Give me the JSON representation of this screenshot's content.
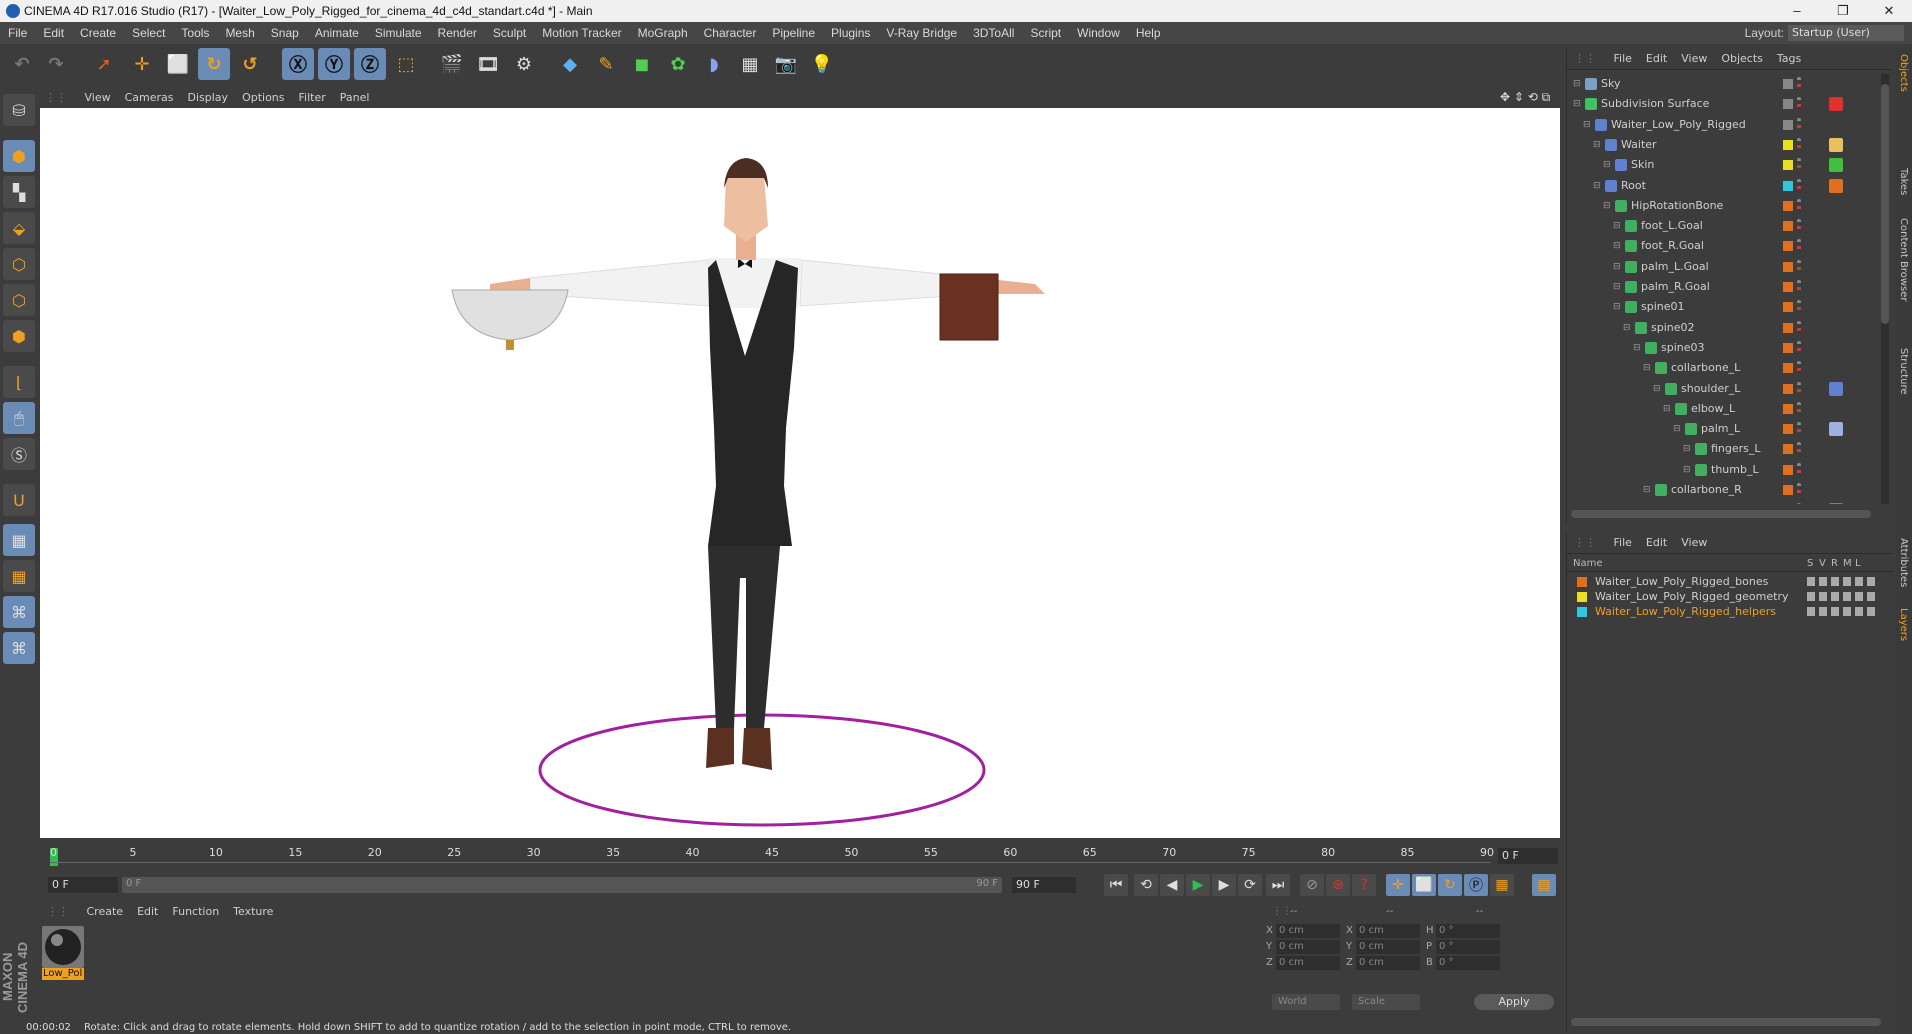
{
  "window": {
    "title": "CINEMA 4D R17.016 Studio (R17) - [Waiter_Low_Poly_Rigged_for_cinema_4d_c4d_standart.c4d *] - Main",
    "controls": [
      "–",
      "❐",
      "✕"
    ]
  },
  "menubar": {
    "items": [
      "File",
      "Edit",
      "Create",
      "Select",
      "Tools",
      "Mesh",
      "Snap",
      "Animate",
      "Simulate",
      "Render",
      "Sculpt",
      "Motion Tracker",
      "MoGraph",
      "Character",
      "Pipeline",
      "Plugins",
      "V-Ray Bridge",
      "3DToAll",
      "Script",
      "Window",
      "Help"
    ],
    "layout_label": "Layout:",
    "layout_value": "Startup (User)"
  },
  "viewport": {
    "menu": [
      "View",
      "Cameras",
      "Display",
      "Options",
      "Filter",
      "Panel"
    ],
    "nav_icons": [
      "move-view-icon",
      "zoom-view-icon",
      "rotate-view-icon",
      "maximize-view-icon"
    ]
  },
  "timeline": {
    "ticks": [
      "0",
      "5",
      "10",
      "15",
      "20",
      "25",
      "30",
      "35",
      "40",
      "45",
      "50",
      "55",
      "60",
      "65",
      "70",
      "75",
      "80",
      "85",
      "90"
    ],
    "current_frame": "0 F",
    "start_field": "0 F",
    "slider_start": "0 F",
    "slider_end": "90 F",
    "end_field": "90 F"
  },
  "material_manager": {
    "menu": [
      "Create",
      "Edit",
      "Function",
      "Texture"
    ],
    "material_name": "Low_Pol"
  },
  "coordinates": {
    "header": [
      "--",
      "--",
      "--"
    ],
    "rows": [
      {
        "a": "X",
        "av": "0 cm",
        "b": "X",
        "bv": "0 cm",
        "c": "H",
        "cv": "0 °"
      },
      {
        "a": "Y",
        "av": "0 cm",
        "b": "Y",
        "bv": "0 cm",
        "c": "P",
        "cv": "0 °"
      },
      {
        "a": "Z",
        "av": "0 cm",
        "b": "Z",
        "bv": "0 cm",
        "c": "B",
        "cv": "0 °"
      }
    ],
    "space": "World",
    "mode": "Scale",
    "apply": "Apply"
  },
  "status": {
    "time": "00:00:02",
    "message": "Rotate: Click and drag to rotate elements. Hold down SHIFT to add to quantize rotation / add to the selection in point mode, CTRL to remove."
  },
  "object_manager": {
    "menu": [
      "File",
      "Edit",
      "View",
      "Objects",
      "Tags"
    ],
    "objects": [
      {
        "name": "Sky",
        "indent": 0,
        "color": "#888888",
        "tag": ""
      },
      {
        "name": "Subdivision Surface",
        "indent": 0,
        "color": "#888888",
        "tag": "x"
      },
      {
        "name": "Waiter_Low_Poly_Rigged",
        "indent": 1,
        "color": "#888888",
        "tag": ""
      },
      {
        "name": "Waiter",
        "indent": 2,
        "color": "#e8e020",
        "tag": "tex"
      },
      {
        "name": "Skin",
        "indent": 3,
        "color": "#e8e020",
        "tag": "check"
      },
      {
        "name": "Root",
        "indent": 2,
        "color": "#30c8e0",
        "tag": "dot"
      },
      {
        "name": "HipRotationBone",
        "indent": 3,
        "color": "#e07020",
        "tag": ""
      },
      {
        "name": "foot_L.Goal",
        "indent": 4,
        "color": "#e07020",
        "tag": ""
      },
      {
        "name": "foot_R.Goal",
        "indent": 4,
        "color": "#e07020",
        "tag": ""
      },
      {
        "name": "palm_L.Goal",
        "indent": 4,
        "color": "#e07020",
        "tag": ""
      },
      {
        "name": "palm_R.Goal",
        "indent": 4,
        "color": "#e07020",
        "tag": ""
      },
      {
        "name": "spine01",
        "indent": 4,
        "color": "#e07020",
        "tag": ""
      },
      {
        "name": "spine02",
        "indent": 5,
        "color": "#e07020",
        "tag": ""
      },
      {
        "name": "spine03",
        "indent": 6,
        "color": "#e07020",
        "tag": ""
      },
      {
        "name": "collarbone_L",
        "indent": 7,
        "color": "#e07020",
        "tag": ""
      },
      {
        "name": "shoulder_L",
        "indent": 8,
        "color": "#e07020",
        "tag": "ik"
      },
      {
        "name": "elbow_L",
        "indent": 9,
        "color": "#e07020",
        "tag": ""
      },
      {
        "name": "palm_L",
        "indent": 10,
        "color": "#e07020",
        "tag": "ik2"
      },
      {
        "name": "fingers_L",
        "indent": 11,
        "color": "#e07020",
        "tag": ""
      },
      {
        "name": "thumb_L",
        "indent": 11,
        "color": "#e07020",
        "tag": ""
      },
      {
        "name": "collarbone_R",
        "indent": 7,
        "color": "#e07020",
        "tag": ""
      },
      {
        "name": "shoulder_R",
        "indent": 8,
        "color": "#e07020",
        "tag": "ik"
      }
    ]
  },
  "layer_manager": {
    "menu": [
      "File",
      "Edit",
      "View"
    ],
    "columns": [
      "Name",
      "S",
      "V",
      "R",
      "M",
      "L"
    ],
    "layers": [
      {
        "name": "Waiter_Low_Poly_Rigged_bones",
        "color": "#e07020",
        "highlight": false
      },
      {
        "name": "Waiter_Low_Poly_Rigged_geometry",
        "color": "#e8e020",
        "highlight": false
      },
      {
        "name": "Waiter_Low_Poly_Rigged_helpers",
        "color": "#30c8e0",
        "highlight": true
      }
    ]
  },
  "right_tabs": [
    "Objects",
    "Takes",
    "Content Browser",
    "Structure",
    "Attributes",
    "Layers"
  ],
  "logo": "MAXON CINEMA 4D",
  "colors": {
    "accent": "#6a8bb5",
    "background": "#3c3c3c",
    "ground_circle": "#a020a0",
    "highlight_layer": "#f0a020"
  }
}
